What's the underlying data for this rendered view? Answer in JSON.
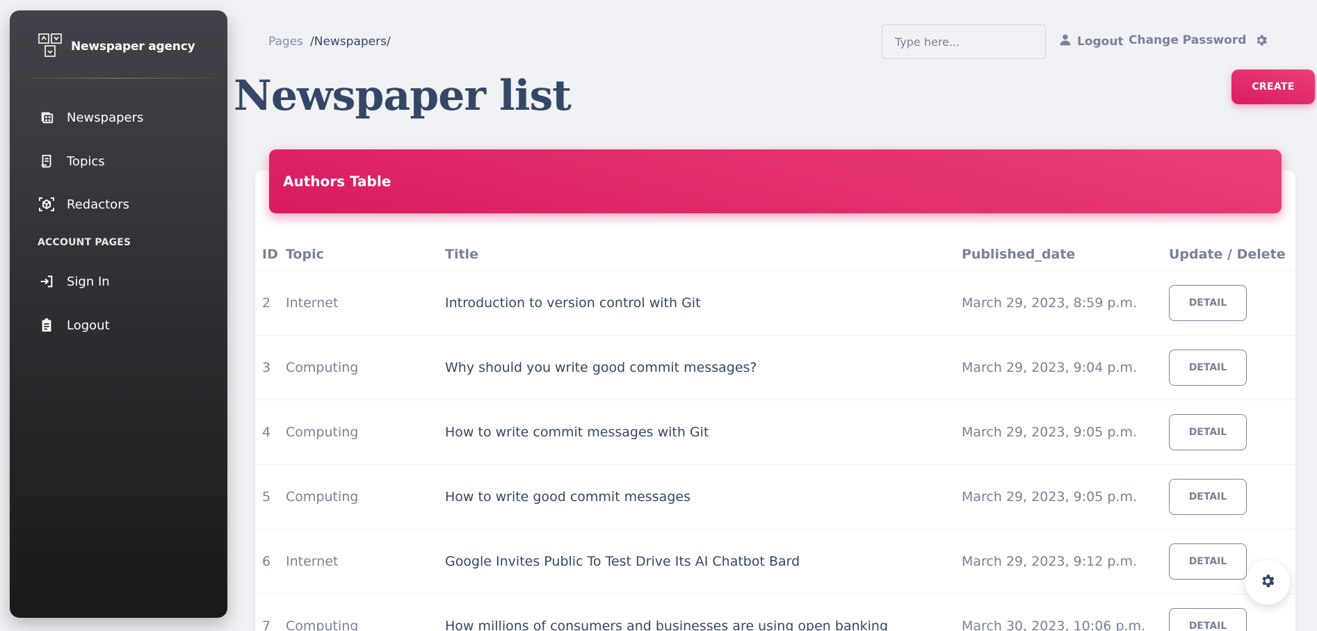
{
  "sidebar": {
    "brand": "Newspaper agency",
    "items": [
      {
        "label": "Newspapers",
        "icon": "newspaper-icon"
      },
      {
        "label": "Topics",
        "icon": "receipt-icon"
      },
      {
        "label": "Redactors",
        "icon": "view-in-ar-icon"
      }
    ],
    "section_label": "ACCOUNT PAGES",
    "account_items": [
      {
        "label": "Sign In",
        "icon": "login-icon"
      },
      {
        "label": "Logout",
        "icon": "assignment-icon"
      }
    ]
  },
  "navbar": {
    "breadcrumb_root": "Pages",
    "breadcrumb_current": "/Newspapers/",
    "search_placeholder": "Type here...",
    "logout_label": "Logout",
    "change_password_label": "Change Password"
  },
  "page": {
    "title": "Newspaper list",
    "create_label": "CREATE"
  },
  "table": {
    "header_title": "Authors Table",
    "columns": [
      "ID",
      "Topic",
      "Title",
      "Published_date",
      "Update / Delete"
    ],
    "detail_label": "DETAIL",
    "rows": [
      {
        "id": "2",
        "topic": "Internet",
        "title": "Introduction to version control with Git",
        "date": "March 29, 2023, 8:59 p.m."
      },
      {
        "id": "3",
        "topic": "Computing",
        "title": "Why should you write good commit messages?",
        "date": "March 29, 2023, 9:04 p.m."
      },
      {
        "id": "4",
        "topic": "Computing",
        "title": "How to write commit messages with Git",
        "date": "March 29, 2023, 9:05 p.m."
      },
      {
        "id": "5",
        "topic": "Computing",
        "title": "How to write good commit messages",
        "date": "March 29, 2023, 9:05 p.m."
      },
      {
        "id": "6",
        "topic": "Internet",
        "title": "Google Invites Public To Test Drive Its AI Chatbot Bard",
        "date": "March 29, 2023, 9:12 p.m."
      },
      {
        "id": "7",
        "topic": "Computing",
        "title": "How millions of consumers and businesses are using open banking",
        "date": "March 30, 2023, 10:06 p.m."
      }
    ]
  },
  "colors": {
    "accent": "#e91e63",
    "text_dark": "#344767",
    "text_muted": "#7b809a"
  }
}
